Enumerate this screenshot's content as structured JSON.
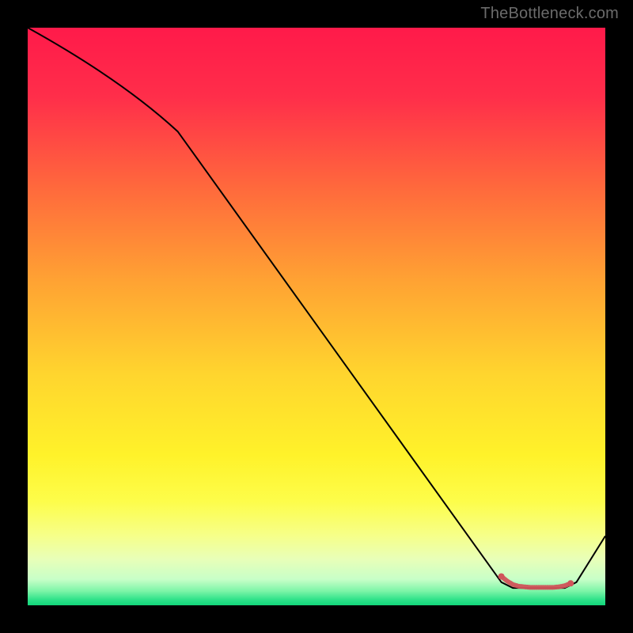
{
  "branding": "TheBottleneck.com",
  "gradient_stops": [
    {
      "offset": 0.0,
      "color": "#ff1a4a"
    },
    {
      "offset": 0.12,
      "color": "#ff2e4a"
    },
    {
      "offset": 0.28,
      "color": "#ff6a3c"
    },
    {
      "offset": 0.44,
      "color": "#ffa333"
    },
    {
      "offset": 0.6,
      "color": "#ffd52e"
    },
    {
      "offset": 0.74,
      "color": "#fff22a"
    },
    {
      "offset": 0.82,
      "color": "#fdfd4a"
    },
    {
      "offset": 0.88,
      "color": "#f6ff8a"
    },
    {
      "offset": 0.92,
      "color": "#e8ffb8"
    },
    {
      "offset": 0.955,
      "color": "#c8ffc8"
    },
    {
      "offset": 0.975,
      "color": "#7ef5a8"
    },
    {
      "offset": 0.99,
      "color": "#2fe28a"
    },
    {
      "offset": 1.0,
      "color": "#12d67a"
    }
  ],
  "chart_data": {
    "type": "line",
    "title": "",
    "xlabel": "",
    "ylabel": "",
    "xlim": [
      0,
      100
    ],
    "ylim": [
      0,
      100
    ],
    "series": [
      {
        "name": "bottleneck-curve",
        "color": "#000000",
        "points": [
          {
            "x": 0,
            "y": 100
          },
          {
            "x": 26,
            "y": 82
          },
          {
            "x": 82,
            "y": 4
          },
          {
            "x": 84,
            "y": 3
          },
          {
            "x": 93,
            "y": 3
          },
          {
            "x": 95,
            "y": 4
          },
          {
            "x": 100,
            "y": 12
          }
        ]
      },
      {
        "name": "optimal-marker",
        "color": "#d0545a",
        "style": "dotted-thick",
        "points": [
          {
            "x": 82,
            "y": 5.0
          },
          {
            "x": 83,
            "y": 4.2
          },
          {
            "x": 84,
            "y": 3.6
          },
          {
            "x": 85,
            "y": 3.3
          },
          {
            "x": 86,
            "y": 3.2
          },
          {
            "x": 87,
            "y": 3.1
          },
          {
            "x": 88,
            "y": 3.1
          },
          {
            "x": 89,
            "y": 3.1
          },
          {
            "x": 90,
            "y": 3.1
          },
          {
            "x": 91,
            "y": 3.1
          },
          {
            "x": 92,
            "y": 3.2
          },
          {
            "x": 93,
            "y": 3.4
          },
          {
            "x": 94,
            "y": 3.8
          }
        ]
      }
    ]
  }
}
